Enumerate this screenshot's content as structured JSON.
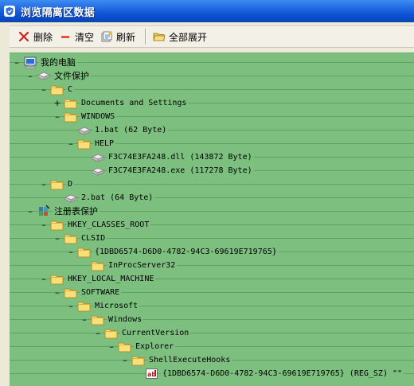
{
  "window": {
    "title": "浏览隔离区数据",
    "icon": "shield-window-icon"
  },
  "toolbar": {
    "delete_label": "删除",
    "clear_label": "清空",
    "refresh_label": "刷新",
    "expand_all_label": "全部展开"
  },
  "tree": {
    "rows": [
      {
        "depth": 0,
        "toggle": "–",
        "icon": "computer-icon",
        "label": "我的电脑",
        "cn": true
      },
      {
        "depth": 1,
        "toggle": "–",
        "icon": "drive-icon",
        "label": "文件保护",
        "cn": true
      },
      {
        "depth": 2,
        "toggle": "–",
        "icon": "folder-icon",
        "label": "C",
        "cn": false
      },
      {
        "depth": 3,
        "toggle": "+",
        "icon": "folder-icon",
        "label": "Documents and Settings",
        "cn": false
      },
      {
        "depth": 3,
        "toggle": "–",
        "icon": "folder-icon",
        "label": "WINDOWS",
        "cn": false
      },
      {
        "depth": 4,
        "toggle": "",
        "icon": "file-icon",
        "label": "1.bat (62 Byte)",
        "cn": false
      },
      {
        "depth": 4,
        "toggle": "–",
        "icon": "folder-icon",
        "label": "HELP",
        "cn": false
      },
      {
        "depth": 5,
        "toggle": "",
        "icon": "file-icon",
        "label": "F3C74E3FA248.dll (143872 Byte)",
        "cn": false
      },
      {
        "depth": 5,
        "toggle": "",
        "icon": "file-icon",
        "label": "F3C74E3FA248.exe (117278 Byte)",
        "cn": false
      },
      {
        "depth": 2,
        "toggle": "–",
        "icon": "folder-icon",
        "label": "D",
        "cn": false
      },
      {
        "depth": 3,
        "toggle": "",
        "icon": "file-icon",
        "label": "2.bat (64 Byte)",
        "cn": false
      },
      {
        "depth": 1,
        "toggle": "–",
        "icon": "registry-icon",
        "label": "注册表保护",
        "cn": true
      },
      {
        "depth": 2,
        "toggle": "–",
        "icon": "folder-icon",
        "label": "HKEY_CLASSES_ROOT",
        "cn": false
      },
      {
        "depth": 3,
        "toggle": "–",
        "icon": "folder-icon",
        "label": "CLSID",
        "cn": false
      },
      {
        "depth": 4,
        "toggle": "–",
        "icon": "folder-icon",
        "label": "{1DBD6574-D6D0-4782-94C3-69619E719765}",
        "cn": false
      },
      {
        "depth": 5,
        "toggle": "",
        "icon": "folder-icon",
        "label": "InProcServer32",
        "cn": false
      },
      {
        "depth": 2,
        "toggle": "–",
        "icon": "folder-icon",
        "label": "HKEY_LOCAL_MACHINE",
        "cn": false
      },
      {
        "depth": 3,
        "toggle": "–",
        "icon": "folder-icon",
        "label": "SOFTWARE",
        "cn": false
      },
      {
        "depth": 4,
        "toggle": "–",
        "icon": "folder-icon",
        "label": "Microsoft",
        "cn": false
      },
      {
        "depth": 5,
        "toggle": "–",
        "icon": "folder-icon",
        "label": "Windows",
        "cn": false
      },
      {
        "depth": 6,
        "toggle": "–",
        "icon": "folder-icon",
        "label": "CurrentVersion",
        "cn": false
      },
      {
        "depth": 7,
        "toggle": "–",
        "icon": "folder-icon",
        "label": "Explorer",
        "cn": false
      },
      {
        "depth": 8,
        "toggle": "–",
        "icon": "folder-icon",
        "label": "ShellExecuteHooks",
        "cn": false
      },
      {
        "depth": 9,
        "toggle": "",
        "icon": "reg-string-icon",
        "label": "{1DBD6574-D6D0-4782-94C3-69619E719765} (REG_SZ) \"\"",
        "cn": false
      }
    ]
  },
  "colors": {
    "tree_background": "#7dbf7f",
    "titlebar": "#0b4fcf"
  }
}
